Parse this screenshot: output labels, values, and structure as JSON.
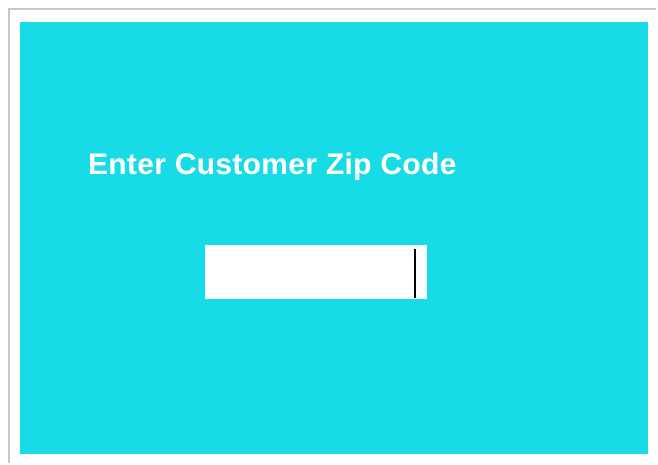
{
  "prompt": {
    "text": "Enter Customer Zip Code"
  },
  "zip_input": {
    "value": "",
    "placeholder": ""
  },
  "colors": {
    "panel_background": "#17dbe6",
    "prompt_text": "#ffffff",
    "input_background": "#ffffff"
  }
}
